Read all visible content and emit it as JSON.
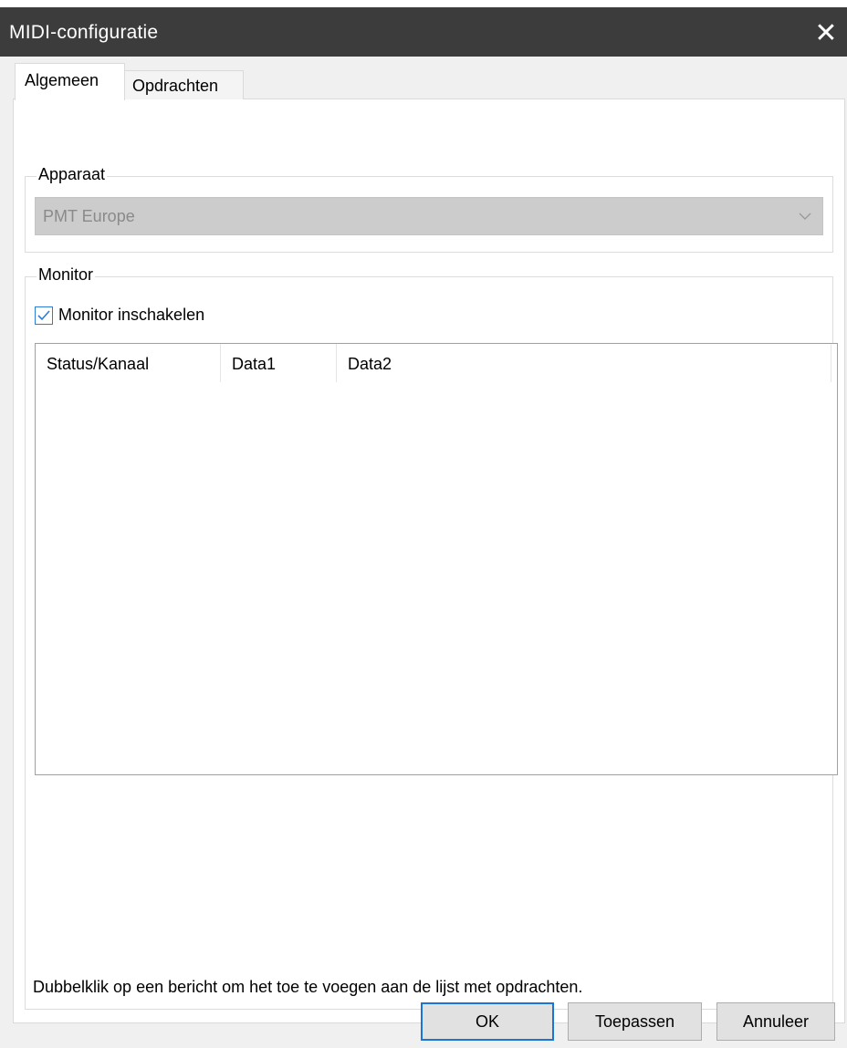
{
  "window": {
    "title": "MIDI-configuratie",
    "close_icon": "close-icon"
  },
  "tabs": [
    {
      "label": "Algemeen",
      "active": true
    },
    {
      "label": "Opdrachten",
      "active": false
    }
  ],
  "apparaat": {
    "legend": "Apparaat",
    "selected_device": "PMT Europe",
    "disabled": true
  },
  "monitor": {
    "legend": "Monitor",
    "enable_label": "Monitor inschakelen",
    "enabled": true,
    "columns": [
      "Status/Kanaal",
      "Data1",
      "Data2"
    ],
    "rows": []
  },
  "hint": "Dubbelklik op een bericht om het toe te voegen aan de lijst met opdrachten.",
  "buttons": {
    "ok": "OK",
    "apply": "Toepassen",
    "cancel": "Annuleer"
  },
  "colors": {
    "titlebar": "#3c3c3c",
    "accent": "#1c75d5",
    "dialog_bg": "#f0f0f0"
  }
}
